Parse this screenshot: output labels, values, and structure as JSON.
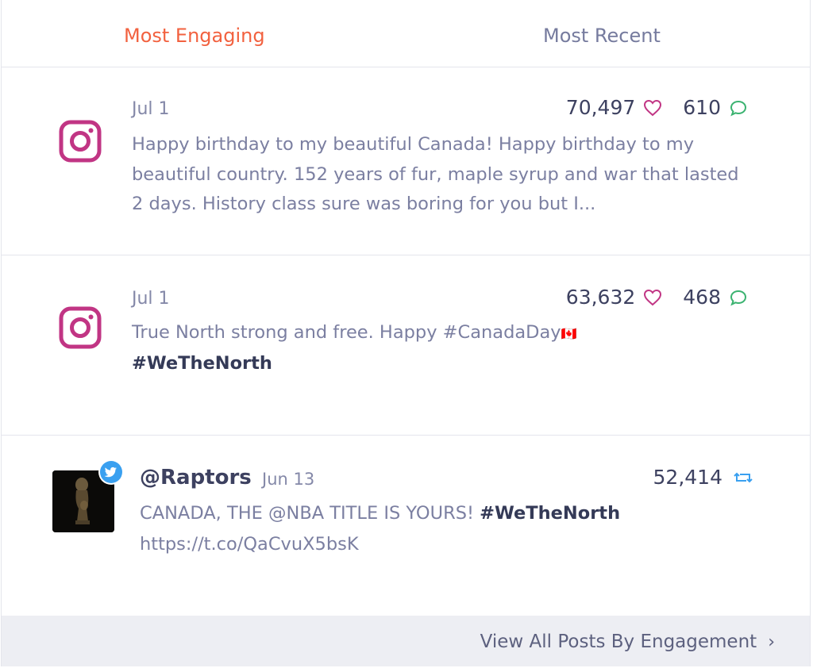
{
  "tabs": {
    "most_engaging": "Most Engaging",
    "most_recent": "Most Recent"
  },
  "posts": [
    {
      "platform_icon": "instagram-icon",
      "date": "Jul 1",
      "likes": "70,497",
      "comments": "610",
      "text": "Happy birthday to my beautiful Canada! Happy birthday to my beautiful country. 152 years of fur, maple syrup and war that lasted 2 days. History class sure was boring for you but I..."
    },
    {
      "platform_icon": "instagram-icon",
      "date": "Jul 1",
      "likes": "63,632",
      "comments": "468",
      "text": "True North strong and free. Happy #CanadaDay",
      "flag": "🇨🇦",
      "hashtag": "#WeTheNorth"
    }
  ],
  "tweet": {
    "handle": "@Raptors",
    "date": "Jun 13",
    "retweets": "52,414",
    "text": "CANADA, THE @NBA TITLE IS YOURS! ",
    "hashtag": "#WeTheNorth",
    "link": "https://t.co/QaCvuX5bsK"
  },
  "footer": {
    "link_label": "View All Posts By Engagement",
    "chevron": "›"
  },
  "colors": {
    "active_tab": "#f2613f",
    "instagram": "#c13584",
    "comment": "#3cb371",
    "retweet": "#3aa0f0",
    "twitter": "#3aa0f0"
  }
}
